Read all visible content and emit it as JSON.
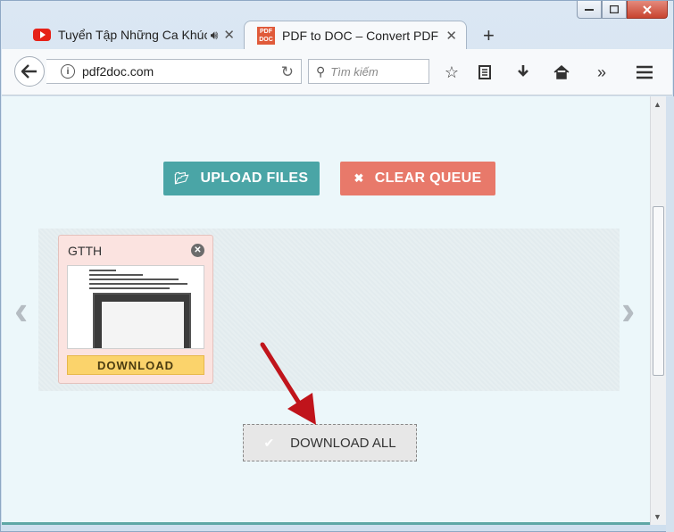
{
  "browser": {
    "tabs": [
      {
        "label": "Tuyển Tập Những Ca Khúc Hay Nhất",
        "icon": "youtube-icon",
        "audio": true,
        "active": false
      },
      {
        "label": "PDF to DOC – Convert PDF to DOC",
        "icon": "pdf2doc-favicon",
        "icon_text": "PDF DOC",
        "active": true
      }
    ],
    "url": "pdf2doc.com",
    "search_placeholder": "Tìm kiếm",
    "colors": {
      "accent_close": "#c8442f",
      "frame": "#cfdfee"
    }
  },
  "page": {
    "upload_label": "UPLOAD FILES",
    "clear_label": "CLEAR QUEUE",
    "files": [
      {
        "name": "GTTH",
        "download_label": "DOWNLOAD"
      }
    ],
    "download_all_label": "DOWNLOAD ALL",
    "colors": {
      "upload": "#4aa5a6",
      "clear": "#e8796a",
      "download": "#fbd36b",
      "annotation_arrow": "#c0141b"
    }
  }
}
